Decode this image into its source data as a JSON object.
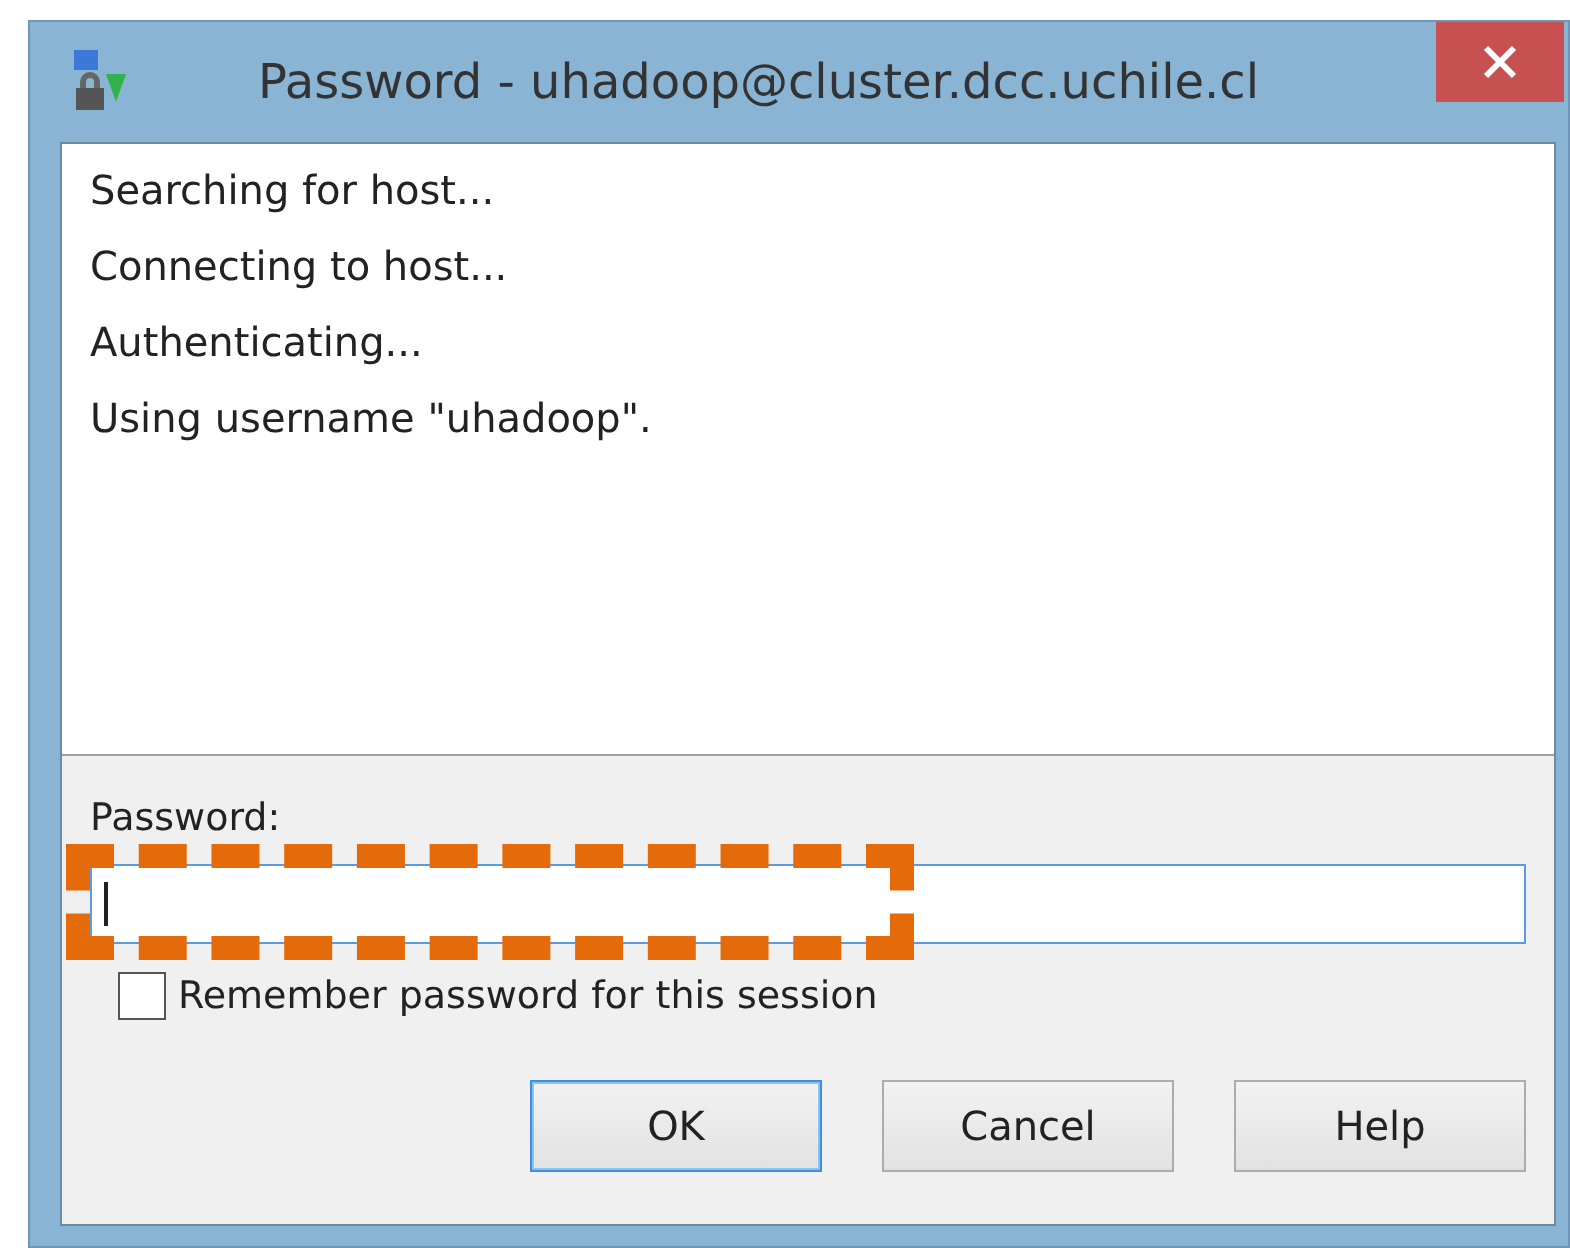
{
  "window": {
    "title": "Password - uhadoop@cluster.dcc.uchile.cl"
  },
  "log": [
    "Searching for host...",
    "Connecting to host...",
    "Authenticating...",
    "Using username \"uhadoop\"."
  ],
  "password": {
    "label": "Password:",
    "focused": true,
    "highlighted": true
  },
  "remember": {
    "label": "Remember password for this session",
    "checked": false
  },
  "buttons": [
    {
      "label": "OK",
      "default": true
    },
    {
      "label": "Cancel",
      "default": false
    },
    {
      "label": "Help",
      "default": false
    }
  ]
}
